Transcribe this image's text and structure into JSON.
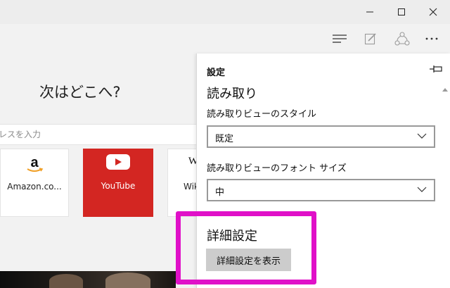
{
  "window": {
    "controls": [
      "minimize-icon",
      "maximize-icon",
      "close-icon"
    ]
  },
  "toolbar": {
    "buttons": [
      "hub-icon",
      "web-note-icon",
      "share-icon",
      "more-icon"
    ]
  },
  "newtab": {
    "heading": "次はどこへ?",
    "search_placeholder": "レスを入力",
    "tiles": [
      {
        "label": "Amazon.co...",
        "icon": "amazon-logo-icon"
      },
      {
        "label": "YouTube",
        "icon": "youtube-play-icon",
        "bg": "#d32622"
      },
      {
        "label": "Wik",
        "icon": "wikipedia-w-icon"
      }
    ]
  },
  "settings_pane": {
    "title": "設定",
    "reading_section": "読み取り",
    "reading_style_label": "読み取りビューのスタイル",
    "reading_style_value": "既定",
    "font_size_label": "読み取りビューのフォント サイズ",
    "font_size_value": "中",
    "advanced_section": "詳細設定",
    "advanced_button": "詳細設定を表示"
  },
  "colors": {
    "highlight": "#e010c8",
    "youtube_red": "#d32622",
    "button_gray": "#cccccc"
  }
}
